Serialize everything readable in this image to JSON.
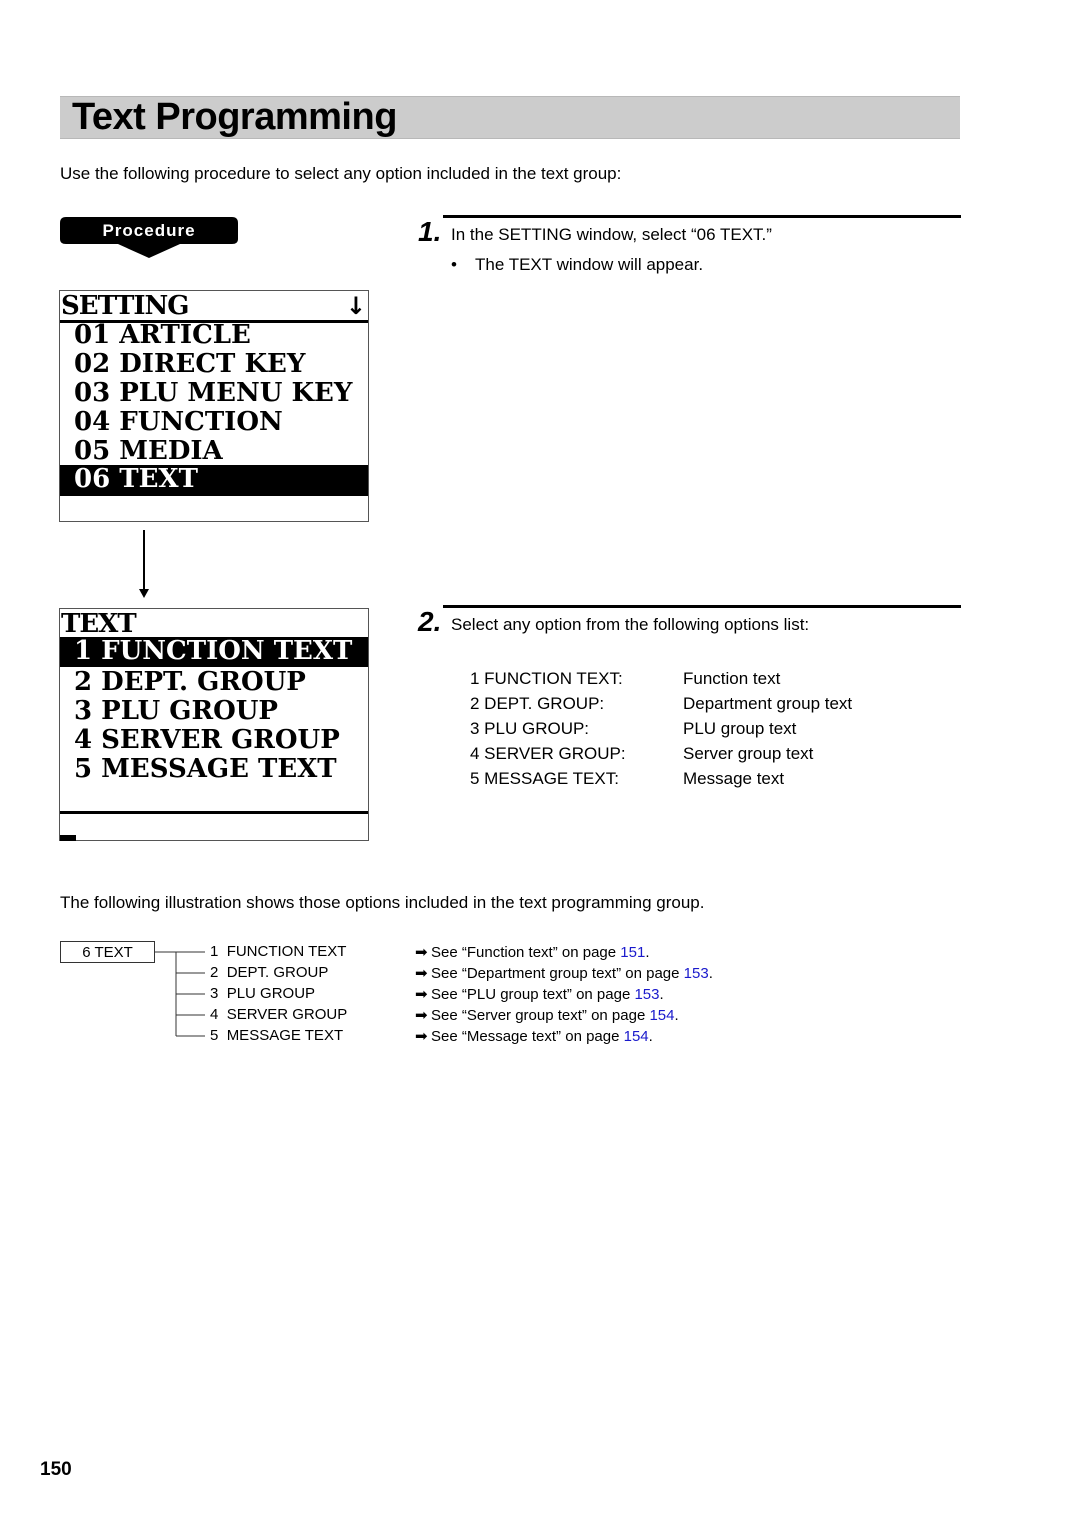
{
  "page": {
    "title": "Text Programming",
    "intro": "Use the following procedure to select any option included in the text group:",
    "procedure_label": "Procedure",
    "page_number": "150"
  },
  "step1": {
    "number": "1.",
    "text": "In the SETTING window, select “06 TEXT.”",
    "bullet": "•",
    "note": "The TEXT window will appear."
  },
  "setting_screen": {
    "title": "SETTING",
    "scroll_icon": "down-arrow-icon",
    "items": [
      {
        "label": "01 ARTICLE",
        "selected": false
      },
      {
        "label": "02 DIRECT KEY",
        "selected": false
      },
      {
        "label": "03 PLU MENU KEY",
        "selected": false
      },
      {
        "label": "04 FUNCTION",
        "selected": false
      },
      {
        "label": "05 MEDIA",
        "selected": false
      },
      {
        "label": "06 TEXT",
        "selected": true
      }
    ]
  },
  "text_screen": {
    "title": "TEXT",
    "items": [
      {
        "label": "1 FUNCTION TEXT",
        "selected": true
      },
      {
        "label": "2 DEPT. GROUP",
        "selected": false
      },
      {
        "label": "3 PLU GROUP",
        "selected": false
      },
      {
        "label": "4 SERVER GROUP",
        "selected": false
      },
      {
        "label": "5 MESSAGE TEXT",
        "selected": false
      }
    ]
  },
  "step2": {
    "number": "2.",
    "text": "Select any option from the following options list:",
    "options": [
      {
        "key": "1 FUNCTION TEXT:",
        "desc": "Function text"
      },
      {
        "key": "2 DEPT. GROUP:",
        "desc": "Department group text"
      },
      {
        "key": "3 PLU GROUP:",
        "desc": "PLU group text"
      },
      {
        "key": "4 SERVER GROUP:",
        "desc": "Server group text"
      },
      {
        "key": "5 MESSAGE TEXT:",
        "desc": "Message text"
      }
    ]
  },
  "illustration": {
    "text": "The following illustration shows those options included in the text programming group.",
    "root": "6 TEXT",
    "arrow_glyph": "➡",
    "items": [
      {
        "num": "1",
        "label": "FUNCTION TEXT",
        "ref_prefix": "See “Function text” on page ",
        "page": "151",
        "ref_suffix": "."
      },
      {
        "num": "2",
        "label": "DEPT. GROUP",
        "ref_prefix": "See “Department group text” on page ",
        "page": "153",
        "ref_suffix": "."
      },
      {
        "num": "3",
        "label": "PLU GROUP",
        "ref_prefix": "See “PLU group text” on page ",
        "page": "153",
        "ref_suffix": "."
      },
      {
        "num": "4",
        "label": "SERVER GROUP",
        "ref_prefix": "See “Server group text” on page ",
        "page": "154",
        "ref_suffix": "."
      },
      {
        "num": "5",
        "label": "MESSAGE TEXT",
        "ref_prefix": "See “Message text” on page ",
        "page": "154",
        "ref_suffix": "."
      }
    ]
  },
  "colors": {
    "title_bar": "#cccccc",
    "link": "#1a1acc"
  }
}
